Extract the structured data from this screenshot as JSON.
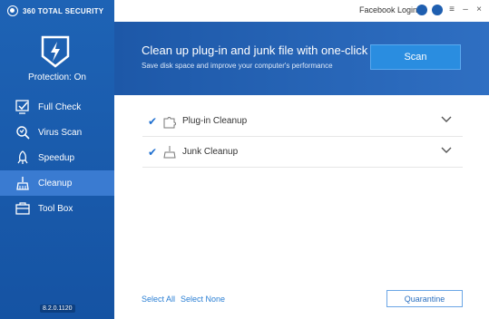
{
  "app": {
    "brand": "360 TOTAL SECURITY",
    "version": "8.2.0.1120"
  },
  "sidebar": {
    "protection_status": "Protection: On",
    "items": [
      {
        "label": "Full Check",
        "icon": "full-check-icon"
      },
      {
        "label": "Virus Scan",
        "icon": "virus-scan-icon"
      },
      {
        "label": "Speedup",
        "icon": "speedup-icon"
      },
      {
        "label": "Cleanup",
        "icon": "cleanup-icon",
        "active": true
      },
      {
        "label": "Tool Box",
        "icon": "toolbox-icon"
      }
    ]
  },
  "topbar": {
    "login_label": "Facebook Login"
  },
  "banner": {
    "title": "Clean up plug-in and junk file with one-click",
    "subtitle": "Save disk space and improve your computer's performance",
    "scan_label": "Scan"
  },
  "cleanup_items": [
    {
      "label": "Plug-in Cleanup",
      "checked": true
    },
    {
      "label": "Junk Cleanup",
      "checked": true
    }
  ],
  "footer": {
    "select_all": "Select All",
    "select_none": "Select None",
    "quarantine": "Quarantine"
  },
  "colors": {
    "sidebar": "#1e63b5",
    "active": "#3a7bd1",
    "accent": "#2a8de0"
  }
}
